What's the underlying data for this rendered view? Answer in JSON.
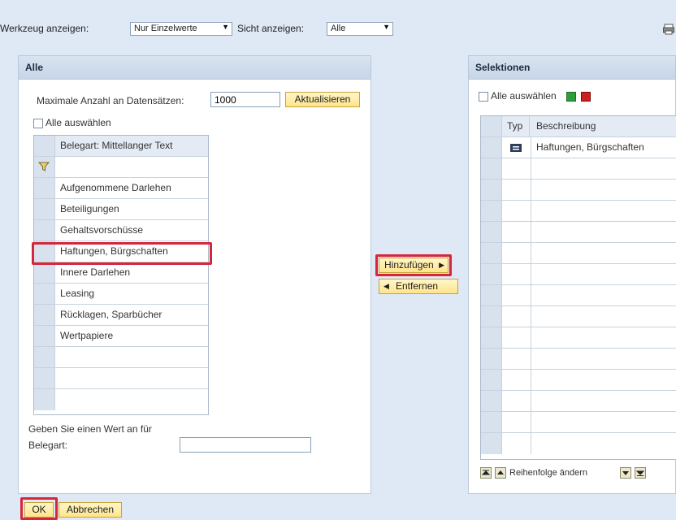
{
  "toolbar": {
    "tool_label": "Werkzeug anzeigen:",
    "tool_value": "Nur Einzelwerte",
    "view_label": "Sicht anzeigen:",
    "view_value": "Alle"
  },
  "left_panel": {
    "title": "Alle",
    "max_label": "Maximale Anzahl an Datensätzen:",
    "max_value": "1000",
    "refresh_button": "Aktualisieren",
    "select_all": "Alle auswählen",
    "column_header": "Belegart: Mittellanger Text",
    "items": [
      "Aufgenommene Darlehen",
      "Beteiligungen",
      "Gehaltsvorschüsse",
      "Haftungen, Bürgschaften",
      "Innere Darlehen",
      "Leasing",
      "Rücklagen, Sparbücher",
      "Wertpapiere"
    ],
    "hint_line1": "Geben Sie einen Wert an für",
    "hint_line2": "Belegart:"
  },
  "middle": {
    "add_button": "Hinzufügen",
    "remove_button": "Entfernen"
  },
  "right_panel": {
    "title": "Selektionen",
    "select_all": "Alle auswählen",
    "col_type": "Typ",
    "col_desc": "Beschreibung",
    "rows": [
      {
        "type_icon": "equals-icon",
        "desc": "Haftungen, Bürgschaften"
      }
    ],
    "reorder_label": "Reihenfolge ändern"
  },
  "footer": {
    "ok_button": "OK",
    "cancel_button": "Abbrechen"
  },
  "colors": {
    "background": "#dfe9f5",
    "highlight": "#d5263b",
    "button": "#ffe48a",
    "green": "#2e9e3a",
    "red": "#cc1f1f"
  }
}
